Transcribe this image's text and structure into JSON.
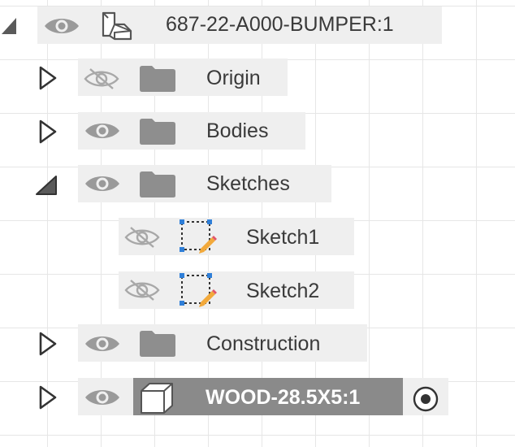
{
  "browser": {
    "root": {
      "label": "687-22-A000-BUMPER:1",
      "expanded": true,
      "visible": true
    },
    "items": [
      {
        "label": "Origin",
        "expanded": false,
        "visible": false,
        "icon": "folder-icon"
      },
      {
        "label": "Bodies",
        "expanded": false,
        "visible": true,
        "icon": "folder-icon"
      },
      {
        "label": "Sketches",
        "expanded": true,
        "visible": true,
        "icon": "folder-icon",
        "children": [
          {
            "label": "Sketch1",
            "visible": false,
            "icon": "sketch-icon"
          },
          {
            "label": "Sketch2",
            "visible": false,
            "icon": "sketch-icon"
          }
        ]
      },
      {
        "label": "Construction",
        "expanded": false,
        "visible": true,
        "icon": "folder-icon"
      },
      {
        "label": "WOOD-28.5X5:1",
        "expanded": false,
        "visible": true,
        "icon": "component-icon",
        "active": true
      }
    ]
  },
  "colors": {
    "row_bg": "#efefef",
    "icon_gray": "#8e8e8e",
    "active_bar": "#8a8a8a",
    "sketch_blue": "#2f7fd8",
    "sketch_pencil": "#f2a93b"
  }
}
